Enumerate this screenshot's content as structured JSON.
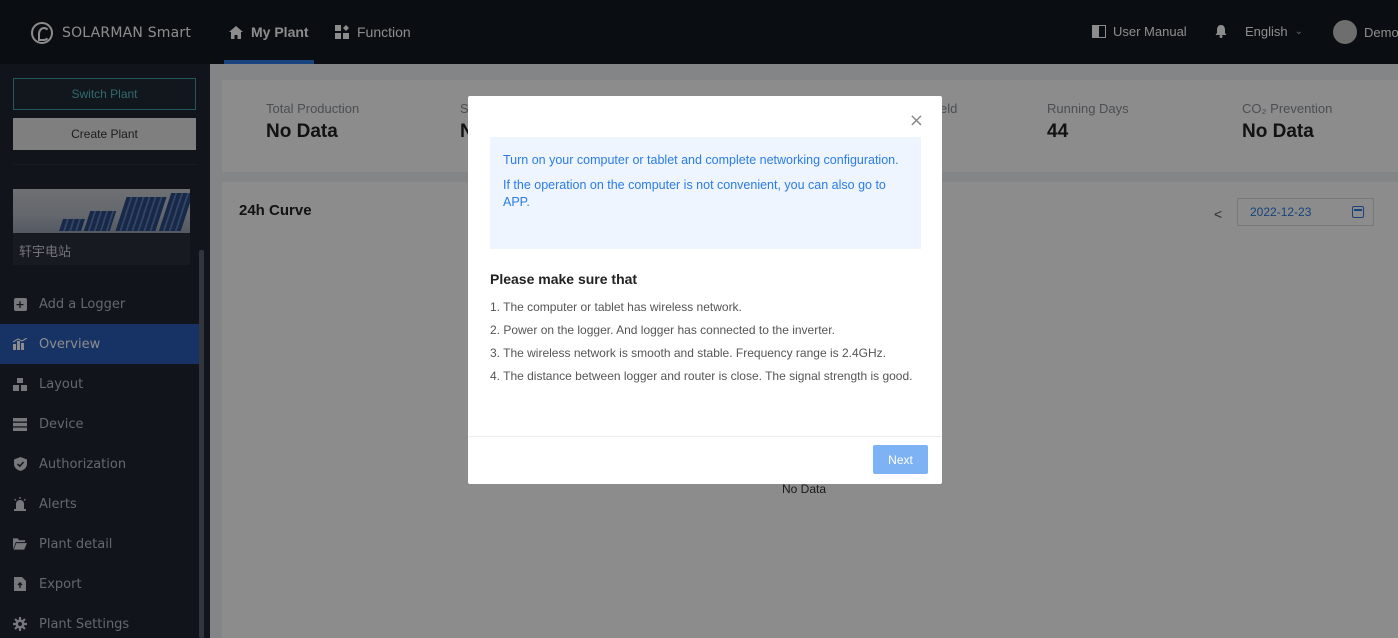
{
  "app": {
    "brand": "SOLARMAN Smart"
  },
  "topnav": {
    "tabs": [
      {
        "label": "My Plant",
        "icon": "home-icon",
        "active": true
      },
      {
        "label": "Function",
        "icon": "grid-icon",
        "active": false
      }
    ],
    "user_manual": "User Manual",
    "language": "English",
    "user": "Demo"
  },
  "sidebar": {
    "switch_plant": "Switch Plant",
    "create_plant": "Create Plant",
    "plant_name": "轩宇电站",
    "items": [
      {
        "label": "Add a Logger",
        "icon": "plus-box-icon"
      },
      {
        "label": "Overview",
        "icon": "chart-icon",
        "active": true
      },
      {
        "label": "Layout",
        "icon": "layout-icon"
      },
      {
        "label": "Device",
        "icon": "device-icon"
      },
      {
        "label": "Authorization",
        "icon": "shield-icon"
      },
      {
        "label": "Alerts",
        "icon": "alarm-icon"
      },
      {
        "label": "Plant detail",
        "icon": "folder-icon"
      },
      {
        "label": "Export",
        "icon": "export-icon"
      },
      {
        "label": "Plant Settings",
        "icon": "gear-icon"
      }
    ]
  },
  "stats": [
    {
      "label": "Total Production",
      "value": "No Data"
    },
    {
      "label": "S",
      "value": "N"
    },
    {
      "label": "eld",
      "value": ""
    },
    {
      "label": "Running Days",
      "value": "44"
    },
    {
      "label": "CO₂ Prevention",
      "value": "No Data"
    }
  ],
  "curve": {
    "title": "24h Curve",
    "date": "2022-12-23",
    "no_data": "No Data"
  },
  "modal": {
    "info_lines": [
      "Turn on your computer or tablet and complete networking configuration.",
      "If the operation on the computer is not convenient, you can also go to APP."
    ],
    "sure_title": "Please make sure that",
    "steps": [
      "1. The computer or tablet has wireless network.",
      "2. Power on the logger. And logger has connected to the inverter.",
      "3. The wireless network is smooth and stable. Frequency range is 2.4GHz.",
      "4. The distance between logger and router is close. The signal strength is good."
    ],
    "next_label": "Next",
    "close_icon": "close-icon"
  },
  "colors": {
    "topbar": "#131820",
    "sidebar": "#1f2530",
    "active_menu": "#2a5cb8",
    "accent": "#2c7be5",
    "next_button": "#7db3f4"
  }
}
